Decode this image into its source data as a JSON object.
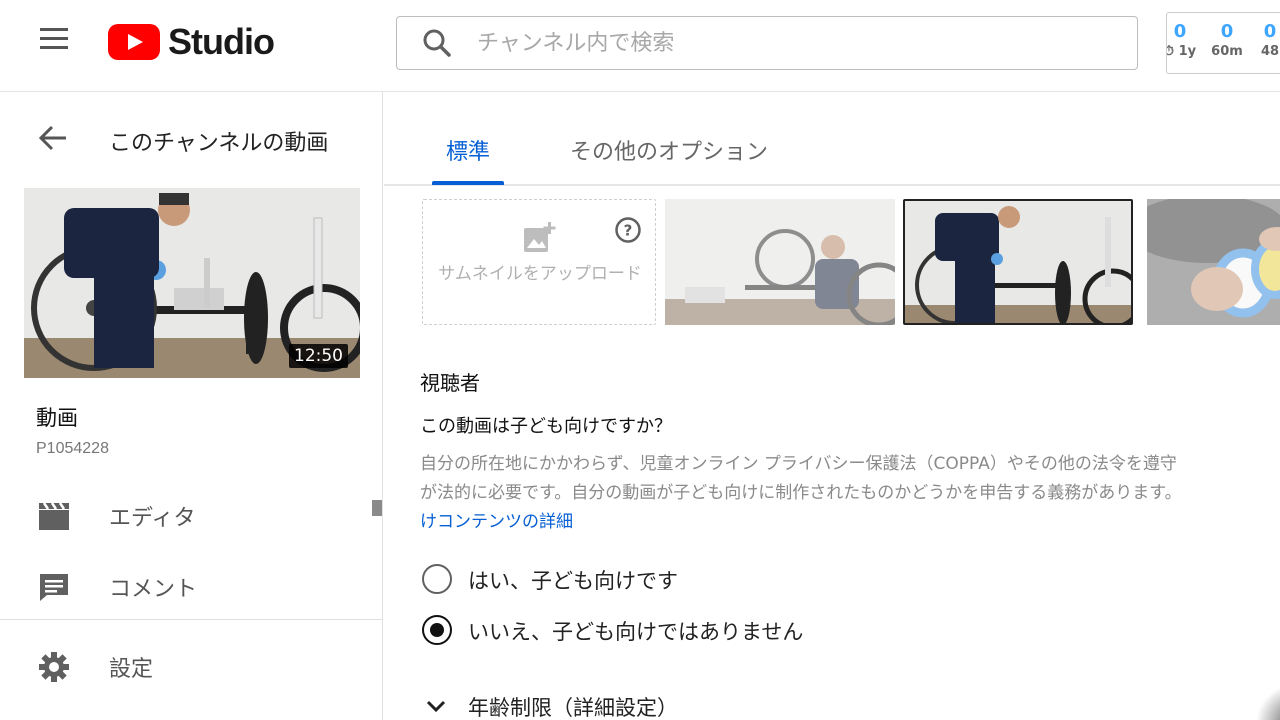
{
  "header": {
    "logo_text": "Studio",
    "search_placeholder": "チャンネル内で検索",
    "stats": [
      {
        "value": "0",
        "label": "⏱ 1y"
      },
      {
        "value": "0",
        "label": "60m"
      },
      {
        "value": "0",
        "label": "48"
      }
    ]
  },
  "sidebar": {
    "back_title": "このチャンネルの動画",
    "thumbnail_duration": "12:50",
    "video_label": "動画",
    "video_name": "P1054228",
    "nav": [
      {
        "label": "エディタ",
        "icon": "editor-clapper-icon"
      },
      {
        "label": "コメント",
        "icon": "comment-icon"
      },
      {
        "label": "設定",
        "icon": "gear-icon"
      }
    ]
  },
  "main": {
    "tabs": [
      {
        "label": "標準",
        "active": true
      },
      {
        "label": "その他のオプション",
        "active": false
      }
    ],
    "upload_thumbnail_label": "サムネイルをアップロード",
    "audience": {
      "title": "視聴者",
      "question": "この動画は子ども向けですか？",
      "description_line1": "自分の所在地にかかわらず、児童オンライン プライバシー保護法（COPPA）やその他の法令を遵守",
      "description_line2": "が法的に必要です。自分の動画が子ども向けに制作されたものかどうかを申告する義務があります。",
      "link_text": "けコンテンツの詳細",
      "options": [
        {
          "label": "はい、子ども向けです",
          "checked": false
        },
        {
          "label": "いいえ、子ども向けではありません",
          "checked": true
        }
      ],
      "age_restriction_label": "年齢制限（詳細設定）"
    }
  },
  "colors": {
    "accent": "#065fd4",
    "brand_red": "#ff0000",
    "stat_blue": "#3ea6ff"
  }
}
